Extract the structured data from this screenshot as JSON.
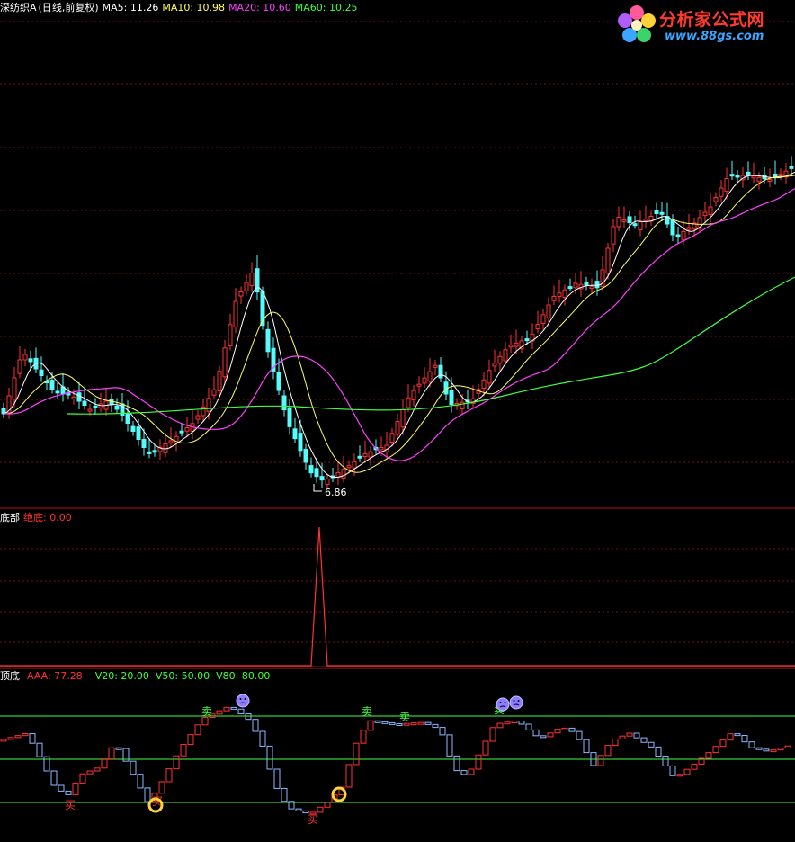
{
  "main": {
    "stock_name": "深纺织A",
    "period": "(日线,前复权)",
    "ma5": "MA5: 11.26",
    "ma10": "MA10: 10.98",
    "ma20": "MA20: 10.60",
    "ma60": "MA60: 10.25",
    "low_label": "6.86",
    "colors": {
      "ma5": "#ffffff",
      "ma10": "#ffff64",
      "ma20": "#ff40ff",
      "ma60": "#40ff40",
      "up": "#ff3232",
      "down": "#54fcfc"
    }
  },
  "logo": {
    "brand": "分析家公式网",
    "url": "www.88gs.com"
  },
  "bottom": {
    "title": "底部",
    "series": "绝底: 0.00"
  },
  "indicator": {
    "title": "顶底",
    "aaa": "AAA: 77.28",
    "levels": "V20: 20.00  V50: 50.00  V80: 80.00",
    "sell_label": "卖",
    "buy_label": "买"
  },
  "chart_data": {
    "type": "candlestick",
    "title": "深纺织A (日线,前复权)",
    "series": [
      {
        "name": "MA5",
        "value": 11.26
      },
      {
        "name": "MA10",
        "value": 10.98
      },
      {
        "name": "MA20",
        "value": 10.6
      },
      {
        "name": "MA60",
        "value": 10.25
      }
    ],
    "annotations": [
      "6.86"
    ],
    "indicators": [
      {
        "name": "绝底",
        "value": 0.0
      },
      {
        "name": "AAA",
        "value": 77.28
      },
      {
        "name": "V20",
        "value": 20.0
      },
      {
        "name": "V50",
        "value": 50.0
      },
      {
        "name": "V80",
        "value": 80.0
      }
    ]
  }
}
